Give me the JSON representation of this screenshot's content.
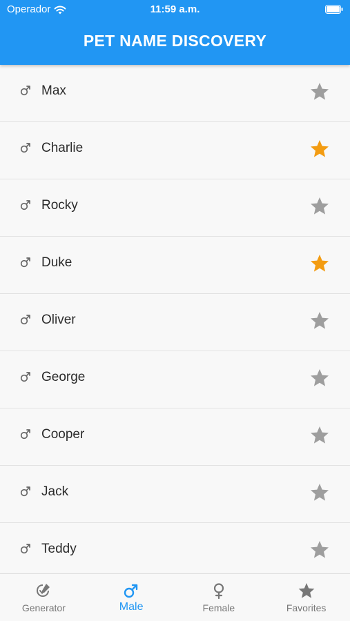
{
  "status_bar": {
    "carrier": "Operador",
    "time": "11:59 a.m."
  },
  "header": {
    "title": "PET NAME DISCOVERY"
  },
  "colors": {
    "primary": "#2196f3",
    "star_active": "#f39c12",
    "star_inactive": "#9e9e9e",
    "gender_icon": "#666666"
  },
  "names": [
    {
      "name": "Max",
      "gender_icon": "male-icon",
      "favorite": false
    },
    {
      "name": "Charlie",
      "gender_icon": "male-icon",
      "favorite": true
    },
    {
      "name": "Rocky",
      "gender_icon": "male-icon",
      "favorite": false
    },
    {
      "name": "Duke",
      "gender_icon": "male-icon",
      "favorite": true
    },
    {
      "name": "Oliver",
      "gender_icon": "male-icon",
      "favorite": false
    },
    {
      "name": "George",
      "gender_icon": "male-icon",
      "favorite": false
    },
    {
      "name": "Cooper",
      "gender_icon": "male-icon",
      "favorite": false
    },
    {
      "name": "Jack",
      "gender_icon": "male-icon",
      "favorite": false
    },
    {
      "name": "Teddy",
      "gender_icon": "male-icon",
      "favorite": false
    }
  ],
  "tabbar": {
    "tabs": [
      {
        "label": "Generator",
        "icon": "generator-icon",
        "active": false
      },
      {
        "label": "Male",
        "icon": "male-icon",
        "active": true
      },
      {
        "label": "Female",
        "icon": "female-icon",
        "active": false
      },
      {
        "label": "Favorites",
        "icon": "star-icon",
        "active": false
      }
    ]
  }
}
